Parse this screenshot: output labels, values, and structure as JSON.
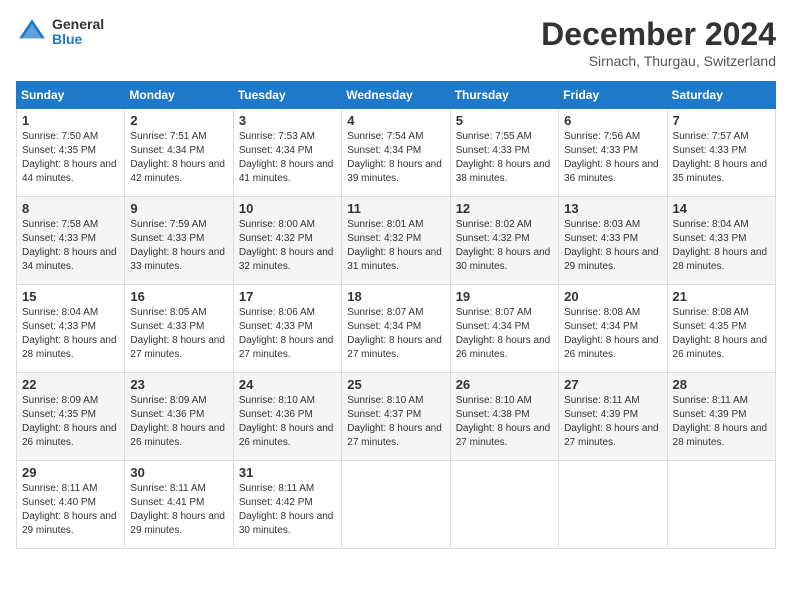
{
  "header": {
    "logo_general": "General",
    "logo_blue": "Blue",
    "month_title": "December 2024",
    "location": "Sirnach, Thurgau, Switzerland"
  },
  "days_of_week": [
    "Sunday",
    "Monday",
    "Tuesday",
    "Wednesday",
    "Thursday",
    "Friday",
    "Saturday"
  ],
  "weeks": [
    [
      {
        "day": "1",
        "sunrise": "7:50 AM",
        "sunset": "4:35 PM",
        "daylight": "8 hours and 44 minutes."
      },
      {
        "day": "2",
        "sunrise": "7:51 AM",
        "sunset": "4:34 PM",
        "daylight": "8 hours and 42 minutes."
      },
      {
        "day": "3",
        "sunrise": "7:53 AM",
        "sunset": "4:34 PM",
        "daylight": "8 hours and 41 minutes."
      },
      {
        "day": "4",
        "sunrise": "7:54 AM",
        "sunset": "4:34 PM",
        "daylight": "8 hours and 39 minutes."
      },
      {
        "day": "5",
        "sunrise": "7:55 AM",
        "sunset": "4:33 PM",
        "daylight": "8 hours and 38 minutes."
      },
      {
        "day": "6",
        "sunrise": "7:56 AM",
        "sunset": "4:33 PM",
        "daylight": "8 hours and 36 minutes."
      },
      {
        "day": "7",
        "sunrise": "7:57 AM",
        "sunset": "4:33 PM",
        "daylight": "8 hours and 35 minutes."
      }
    ],
    [
      {
        "day": "8",
        "sunrise": "7:58 AM",
        "sunset": "4:33 PM",
        "daylight": "8 hours and 34 minutes."
      },
      {
        "day": "9",
        "sunrise": "7:59 AM",
        "sunset": "4:33 PM",
        "daylight": "8 hours and 33 minutes."
      },
      {
        "day": "10",
        "sunrise": "8:00 AM",
        "sunset": "4:32 PM",
        "daylight": "8 hours and 32 minutes."
      },
      {
        "day": "11",
        "sunrise": "8:01 AM",
        "sunset": "4:32 PM",
        "daylight": "8 hours and 31 minutes."
      },
      {
        "day": "12",
        "sunrise": "8:02 AM",
        "sunset": "4:32 PM",
        "daylight": "8 hours and 30 minutes."
      },
      {
        "day": "13",
        "sunrise": "8:03 AM",
        "sunset": "4:33 PM",
        "daylight": "8 hours and 29 minutes."
      },
      {
        "day": "14",
        "sunrise": "8:04 AM",
        "sunset": "4:33 PM",
        "daylight": "8 hours and 28 minutes."
      }
    ],
    [
      {
        "day": "15",
        "sunrise": "8:04 AM",
        "sunset": "4:33 PM",
        "daylight": "8 hours and 28 minutes."
      },
      {
        "day": "16",
        "sunrise": "8:05 AM",
        "sunset": "4:33 PM",
        "daylight": "8 hours and 27 minutes."
      },
      {
        "day": "17",
        "sunrise": "8:06 AM",
        "sunset": "4:33 PM",
        "daylight": "8 hours and 27 minutes."
      },
      {
        "day": "18",
        "sunrise": "8:07 AM",
        "sunset": "4:34 PM",
        "daylight": "8 hours and 27 minutes."
      },
      {
        "day": "19",
        "sunrise": "8:07 AM",
        "sunset": "4:34 PM",
        "daylight": "8 hours and 26 minutes."
      },
      {
        "day": "20",
        "sunrise": "8:08 AM",
        "sunset": "4:34 PM",
        "daylight": "8 hours and 26 minutes."
      },
      {
        "day": "21",
        "sunrise": "8:08 AM",
        "sunset": "4:35 PM",
        "daylight": "8 hours and 26 minutes."
      }
    ],
    [
      {
        "day": "22",
        "sunrise": "8:09 AM",
        "sunset": "4:35 PM",
        "daylight": "8 hours and 26 minutes."
      },
      {
        "day": "23",
        "sunrise": "8:09 AM",
        "sunset": "4:36 PM",
        "daylight": "8 hours and 26 minutes."
      },
      {
        "day": "24",
        "sunrise": "8:10 AM",
        "sunset": "4:36 PM",
        "daylight": "8 hours and 26 minutes."
      },
      {
        "day": "25",
        "sunrise": "8:10 AM",
        "sunset": "4:37 PM",
        "daylight": "8 hours and 27 minutes."
      },
      {
        "day": "26",
        "sunrise": "8:10 AM",
        "sunset": "4:38 PM",
        "daylight": "8 hours and 27 minutes."
      },
      {
        "day": "27",
        "sunrise": "8:11 AM",
        "sunset": "4:39 PM",
        "daylight": "8 hours and 27 minutes."
      },
      {
        "day": "28",
        "sunrise": "8:11 AM",
        "sunset": "4:39 PM",
        "daylight": "8 hours and 28 minutes."
      }
    ],
    [
      {
        "day": "29",
        "sunrise": "8:11 AM",
        "sunset": "4:40 PM",
        "daylight": "8 hours and 29 minutes."
      },
      {
        "day": "30",
        "sunrise": "8:11 AM",
        "sunset": "4:41 PM",
        "daylight": "8 hours and 29 minutes."
      },
      {
        "day": "31",
        "sunrise": "8:11 AM",
        "sunset": "4:42 PM",
        "daylight": "8 hours and 30 minutes."
      },
      null,
      null,
      null,
      null
    ]
  ]
}
